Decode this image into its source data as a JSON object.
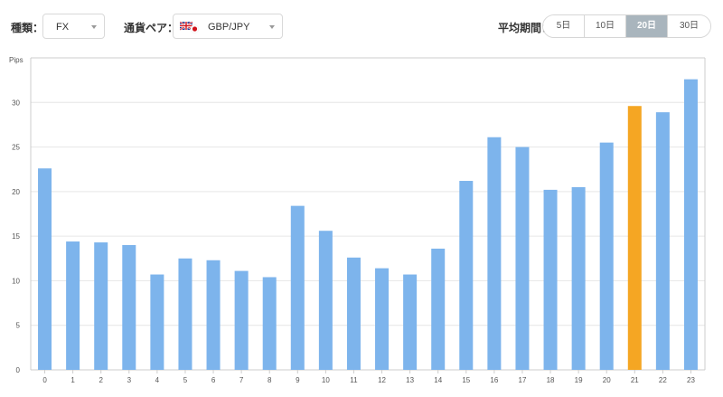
{
  "controls": {
    "type_label": "種類：",
    "type_value": "FX",
    "pair_label": "通貨ペア：",
    "pair_value": "GBP/JPY",
    "period_label": "平均期間：",
    "periods": [
      "5日",
      "10日",
      "20日",
      "30日"
    ],
    "active_period": "20日"
  },
  "chart_data": {
    "type": "bar",
    "ylabel": "Pips",
    "ylim": [
      0,
      35
    ],
    "yticks": [
      0,
      5,
      10,
      15,
      20,
      25,
      30
    ],
    "grid": true,
    "categories": [
      "0",
      "1",
      "2",
      "3",
      "4",
      "5",
      "6",
      "7",
      "8",
      "9",
      "10",
      "11",
      "12",
      "13",
      "14",
      "15",
      "16",
      "17",
      "18",
      "19",
      "20",
      "21",
      "22",
      "23"
    ],
    "values": [
      22.6,
      14.4,
      14.3,
      14.0,
      10.7,
      12.5,
      12.3,
      11.1,
      10.4,
      18.4,
      15.6,
      12.6,
      11.4,
      10.7,
      13.6,
      21.2,
      26.1,
      25.0,
      20.2,
      20.5,
      25.5,
      29.6,
      28.9,
      32.6
    ],
    "highlight_index": 21,
    "colors": {
      "bar": "#7db4ec",
      "highlight": "#f5a623",
      "grid": "#e6e6e6",
      "axis": "#cccccc"
    }
  }
}
